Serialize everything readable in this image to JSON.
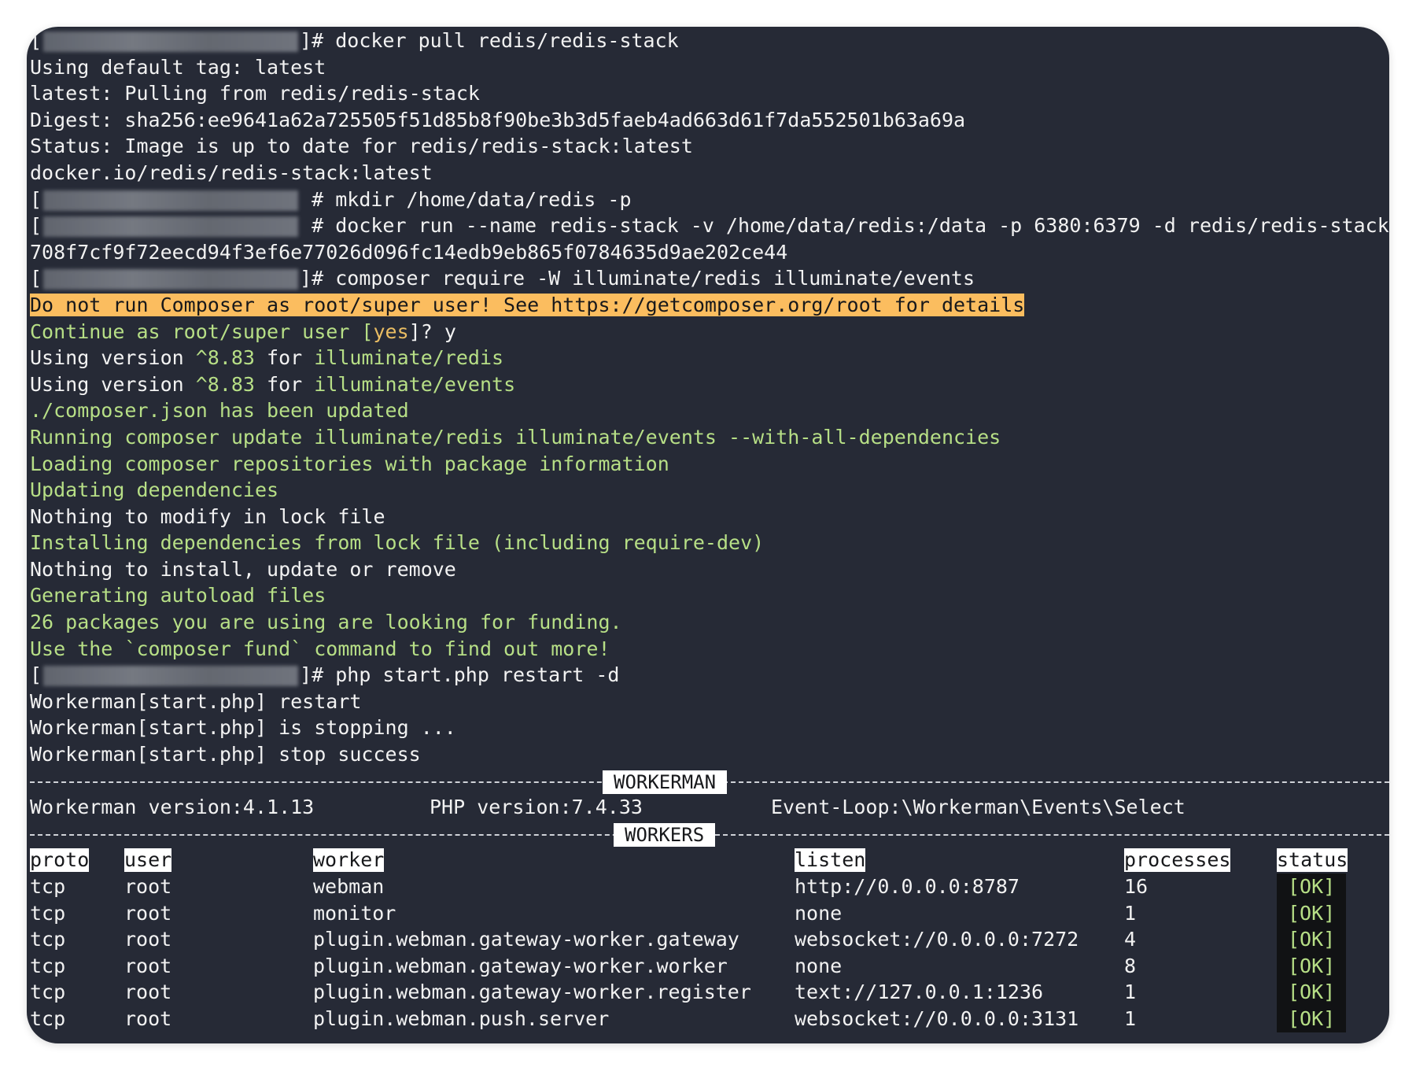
{
  "terminal": {
    "lines": [
      {
        "kind": "prompt",
        "open": "[",
        "close": "]#",
        "cmd": " docker pull redis/redis-stack"
      },
      {
        "kind": "text",
        "text": "Using default tag: latest"
      },
      {
        "kind": "text",
        "text": "latest: Pulling from redis/redis-stack"
      },
      {
        "kind": "text",
        "text": "Digest: sha256:ee9641a62a725505f51d85b8f90be3b3d5faeb4ad663d61f7da552501b63a69a"
      },
      {
        "kind": "text",
        "text": "Status: Image is up to date for redis/redis-stack:latest"
      },
      {
        "kind": "text",
        "text": "docker.io/redis/redis-stack:latest"
      },
      {
        "kind": "prompt",
        "open": "[",
        "close": " #",
        "cmd": " mkdir /home/data/redis -p"
      },
      {
        "kind": "prompt",
        "open": "[",
        "close": " #",
        "cmd": " docker run --name redis-stack -v /home/data/redis:/data -p 6380:6379 -d redis/redis-stack"
      },
      {
        "kind": "text",
        "text": "708f7cf9f72eecd94f3ef6e77026d096fc14edb9eb865f0784635d9ae202ce44"
      },
      {
        "kind": "prompt",
        "open": "[",
        "close": "]#",
        "cmd": " composer require -W illuminate/redis illuminate/events"
      },
      {
        "kind": "warn",
        "text": "Do not run Composer as root/super user! See https://getcomposer.org/root for details"
      },
      {
        "kind": "confirm",
        "a": "Continue as root/super user [",
        "b": "yes",
        "c": "]? ",
        "d": "y"
      },
      {
        "kind": "version",
        "a": "Using version ",
        "b": "^8.83",
        "c": " for ",
        "d": "illuminate/redis"
      },
      {
        "kind": "version",
        "a": "Using version ",
        "b": "^8.83",
        "c": " for ",
        "d": "illuminate/events"
      },
      {
        "kind": "green",
        "text": "./composer.json has been updated"
      },
      {
        "kind": "green",
        "text": "Running composer update illuminate/redis illuminate/events --with-all-dependencies"
      },
      {
        "kind": "green",
        "text": "Loading composer repositories with package information"
      },
      {
        "kind": "green",
        "text": "Updating dependencies"
      },
      {
        "kind": "text",
        "text": "Nothing to modify in lock file"
      },
      {
        "kind": "green",
        "text": "Installing dependencies from lock file (including require-dev)"
      },
      {
        "kind": "text",
        "text": "Nothing to install, update or remove"
      },
      {
        "kind": "green",
        "text": "Generating autoload files"
      },
      {
        "kind": "green",
        "text": "26 packages you are using are looking for funding."
      },
      {
        "kind": "green",
        "text": "Use the `composer fund` command to find out more!"
      },
      {
        "kind": "prompt",
        "open": "[",
        "close": "]#",
        "cmd": " php start.php restart -d"
      },
      {
        "kind": "text",
        "text": "Workerman[start.php] restart"
      },
      {
        "kind": "text",
        "text": "Workerman[start.php] is stopping ..."
      },
      {
        "kind": "text",
        "text": "Workerman[start.php] stop success"
      }
    ]
  },
  "workerman": {
    "section_label": "WORKERMAN",
    "version": "Workerman version:4.1.13",
    "php": "PHP version:7.4.33",
    "event_loop": "Event-Loop:\\Workerman\\Events\\Select",
    "workers_label": "WORKERS",
    "columns": [
      "proto",
      "user",
      "worker",
      "listen",
      "processes",
      "status"
    ],
    "rows": [
      {
        "proto": "tcp",
        "user": "root",
        "worker": "webman",
        "listen": "http://0.0.0.0:8787",
        "processes": "16",
        "status": "[OK]"
      },
      {
        "proto": "tcp",
        "user": "root",
        "worker": "monitor",
        "listen": "none",
        "processes": "1",
        "status": "[OK]"
      },
      {
        "proto": "tcp",
        "user": "root",
        "worker": "plugin.webman.gateway-worker.gateway",
        "listen": "websocket://0.0.0.0:7272",
        "processes": "4",
        "status": "[OK]"
      },
      {
        "proto": "tcp",
        "user": "root",
        "worker": "plugin.webman.gateway-worker.worker",
        "listen": "none",
        "processes": "8",
        "status": "[OK]"
      },
      {
        "proto": "tcp",
        "user": "root",
        "worker": "plugin.webman.gateway-worker.register",
        "listen": "text://127.0.0.1:1236",
        "processes": "1",
        "status": "[OK]"
      },
      {
        "proto": "tcp",
        "user": "root",
        "worker": "plugin.webman.push.server",
        "listen": "websocket://0.0.0.0:3131",
        "processes": "1",
        "status": "[OK]"
      }
    ]
  }
}
